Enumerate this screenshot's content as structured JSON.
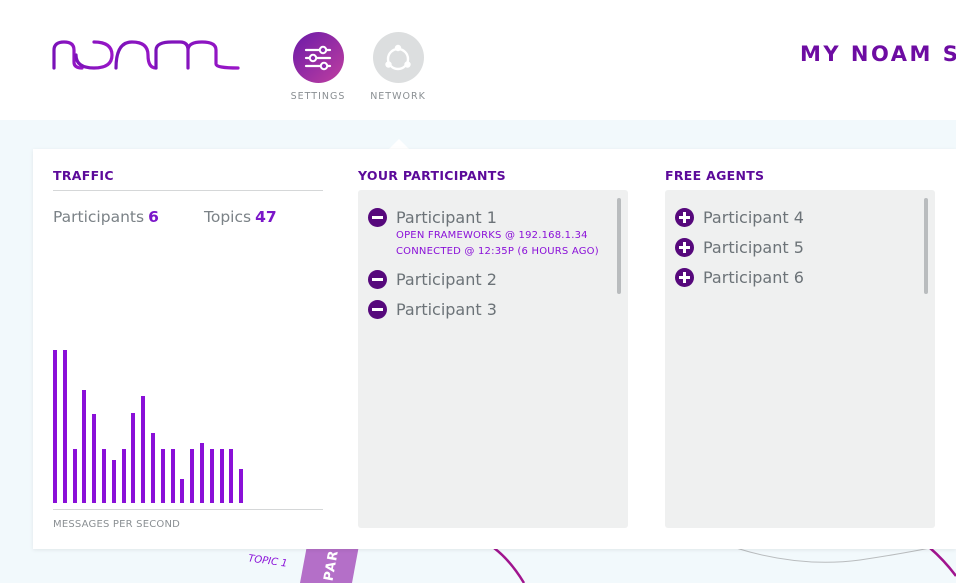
{
  "header": {
    "nav": [
      {
        "label": "SETTINGS",
        "icon": "settings-sliders-icon"
      },
      {
        "label": "NETWORK",
        "icon": "network-icon"
      }
    ],
    "page_title": "MY NOAM SE"
  },
  "traffic": {
    "title": "TRAFFIC",
    "participants_label": "Participants",
    "participants_count": "6",
    "topics_label": "Topics",
    "topics_count": "47",
    "caption": "MESSAGES PER SECOND",
    "chart_data": {
      "type": "bar",
      "title": "",
      "xlabel": "",
      "ylabel": "",
      "ylim": [
        0,
        1
      ],
      "values": [
        1.0,
        1.0,
        0.35,
        0.74,
        0.58,
        0.35,
        0.28,
        0.35,
        0.59,
        0.7,
        0.46,
        0.35,
        0.35,
        0.16,
        0.35,
        0.39,
        0.35,
        0.35,
        0.35,
        0.22
      ]
    }
  },
  "your_participants": {
    "title": "YOUR PARTICIPANTS",
    "items": [
      {
        "name": "Participant 1",
        "line1": "OPEN FRAMEWORKS @ 192.168.1.34",
        "line2": "CONNECTED @ 12:35P (6 HOURS AGO)"
      },
      {
        "name": "Participant 2"
      },
      {
        "name": "Participant 3"
      }
    ]
  },
  "free_agents": {
    "title": "FREE AGENTS",
    "items": [
      {
        "name": "Participant 4"
      },
      {
        "name": "Participant 5"
      },
      {
        "name": "Participant 6"
      }
    ]
  },
  "background": {
    "topic_label": "TOPIC 1",
    "partial_label": "PAR"
  },
  "colors": {
    "brand_purple": "#6d0ca2",
    "bar_purple": "#8a10d8",
    "gray_text": "#7b8287"
  }
}
